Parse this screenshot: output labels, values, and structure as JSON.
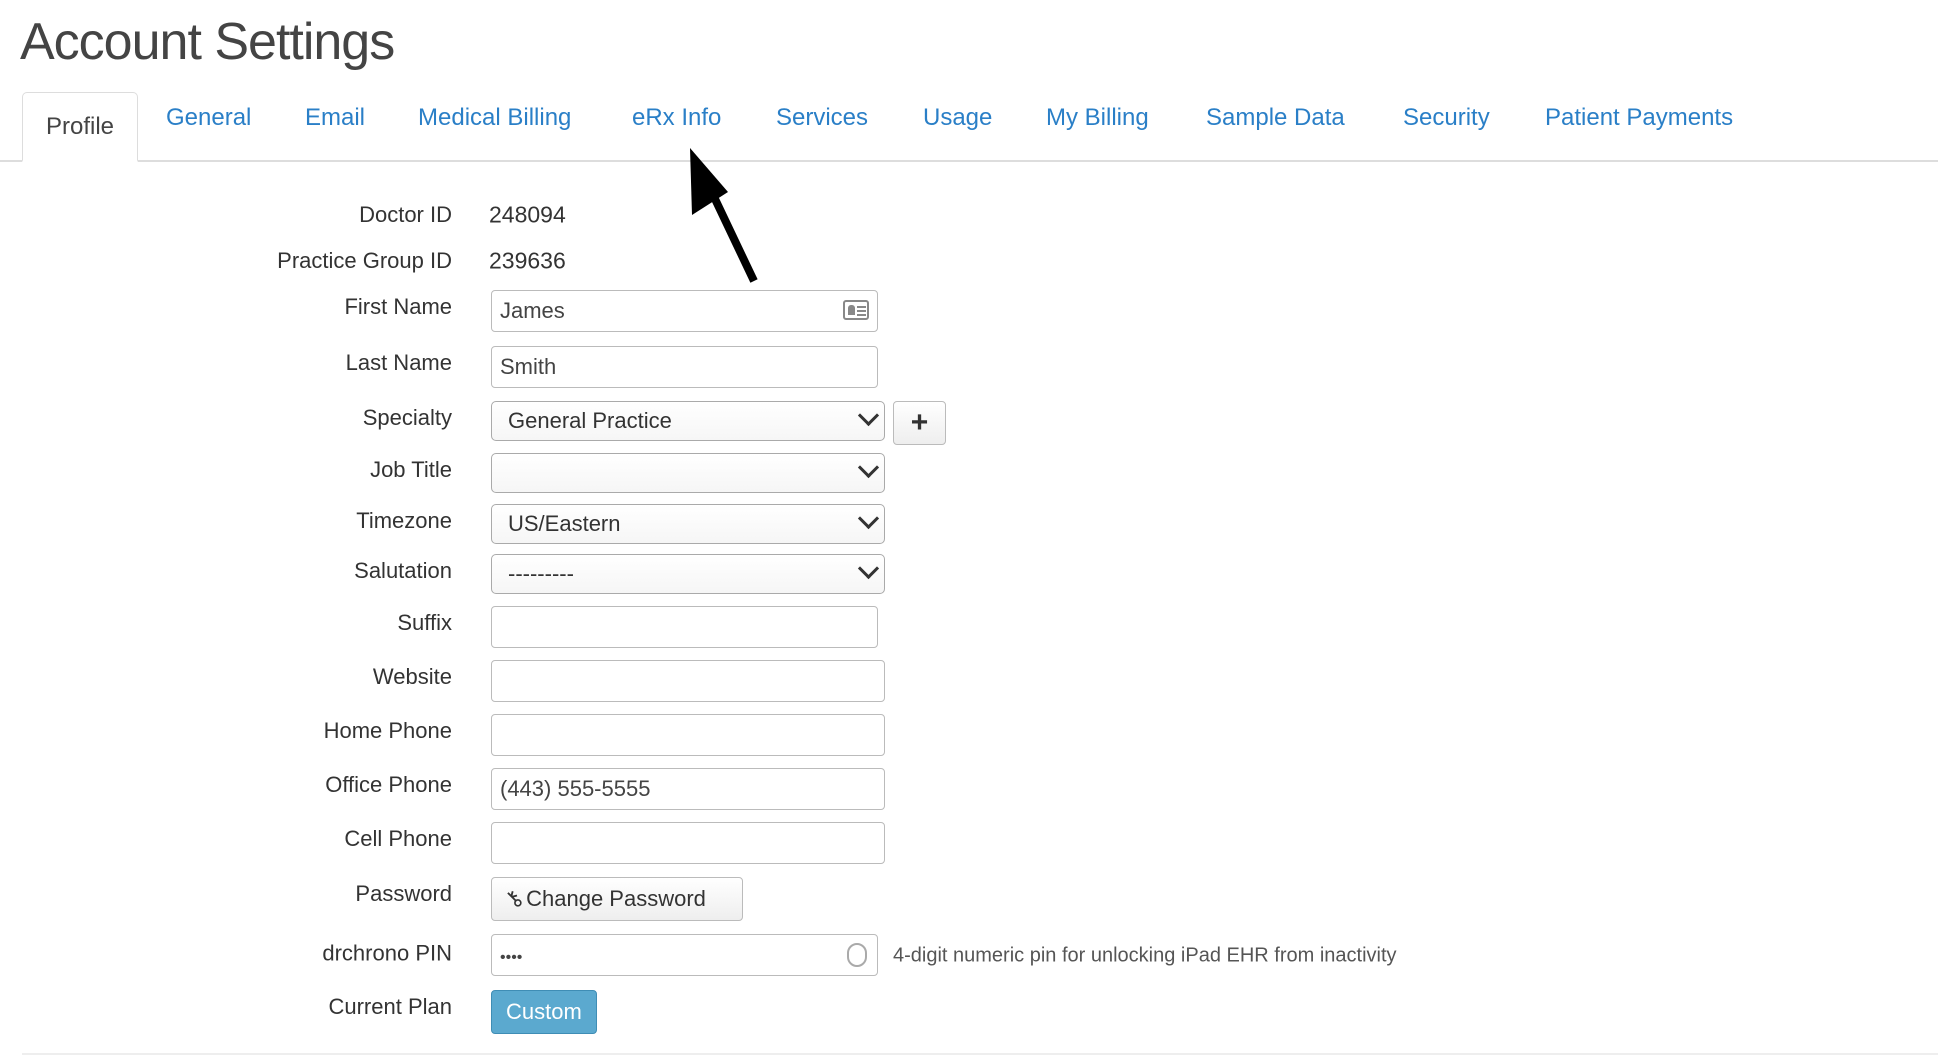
{
  "title": "Account Settings",
  "tabs": [
    "Profile",
    "General",
    "Email",
    "Medical Billing",
    "eRx Info",
    "Services",
    "Usage",
    "My Billing",
    "Sample Data",
    "Security",
    "Patient Payments"
  ],
  "active_tab": "Profile",
  "form": {
    "doctor_id": {
      "label": "Doctor ID",
      "value": "248094"
    },
    "practice_group_id": {
      "label": "Practice Group ID",
      "value": "239636"
    },
    "first_name": {
      "label": "First Name",
      "value": "James"
    },
    "last_name": {
      "label": "Last Name",
      "value": "Smith"
    },
    "specialty": {
      "label": "Specialty",
      "value": "General Practice"
    },
    "job_title": {
      "label": "Job Title",
      "value": ""
    },
    "timezone": {
      "label": "Timezone",
      "value": "US/Eastern"
    },
    "salutation": {
      "label": "Salutation",
      "value": "---------"
    },
    "suffix": {
      "label": "Suffix",
      "value": ""
    },
    "website": {
      "label": "Website",
      "value": ""
    },
    "home_phone": {
      "label": "Home Phone",
      "value": ""
    },
    "office_phone": {
      "label": "Office Phone",
      "value": "(443) 555-5555"
    },
    "cell_phone": {
      "label": "Cell Phone",
      "value": ""
    },
    "password": {
      "label": "Password",
      "button": "Change Password"
    },
    "pin": {
      "label": "drchrono PIN",
      "value": "••••",
      "hint": "4-digit numeric pin for unlocking iPad EHR from inactivity"
    },
    "plan": {
      "label": "Current Plan",
      "value": "Custom"
    }
  },
  "colors": {
    "link": "#2a7fc7",
    "plan_badge": "#5ba9cf"
  }
}
